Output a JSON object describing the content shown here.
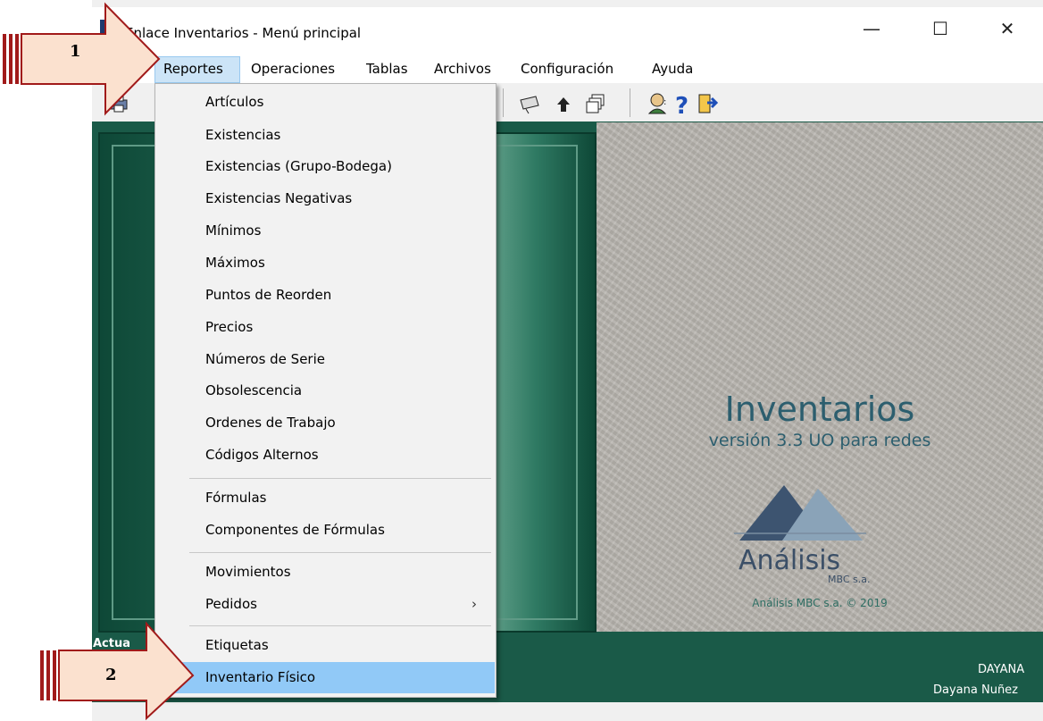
{
  "window": {
    "title": "Enlace Inventarios - Menú principal",
    "minimize": "—",
    "maximize": "☐",
    "close": "✕"
  },
  "menubar": {
    "items": [
      "Reportes",
      "Operaciones",
      "Tablas",
      "Archivos",
      "Configuración",
      "Ayuda"
    ],
    "active": "Reportes"
  },
  "dropdown": {
    "groups": [
      [
        "Artículos",
        "Existencias",
        "Existencias (Grupo-Bodega)",
        "Existencias Negativas",
        "Mínimos",
        "Máximos",
        "Puntos de Reorden",
        "Precios",
        "Números de Serie",
        "Obsolescencia",
        "Ordenes de Trabajo",
        "Códigos Alternos"
      ],
      [
        "Fórmulas",
        "Componentes de Fórmulas"
      ],
      [
        "Movimientos",
        "Pedidos"
      ],
      [
        "Etiquetas",
        "Inventario Físico"
      ]
    ],
    "highlighted": "Inventario Físico",
    "submenu_indicator": "›"
  },
  "splash": {
    "title": "Inventarios",
    "version": "versión 3.3 UO para redes",
    "company": "Análisis",
    "company_sub": "MBC s.a.",
    "copyright": "Análisis MBC s.a. © 2019"
  },
  "statusbar": {
    "left": "Actua",
    "user_short": "DAYANA",
    "user_full": "Dayana Nuñez"
  },
  "annotations": {
    "step1": "1",
    "step2": "2"
  },
  "colors": {
    "client_bg": "#1a5a48",
    "highlight": "#91c9f7",
    "arrow_fill": "#fbe1cf",
    "arrow_stroke": "#a11a1a",
    "brand_text": "#2c5e6e"
  }
}
